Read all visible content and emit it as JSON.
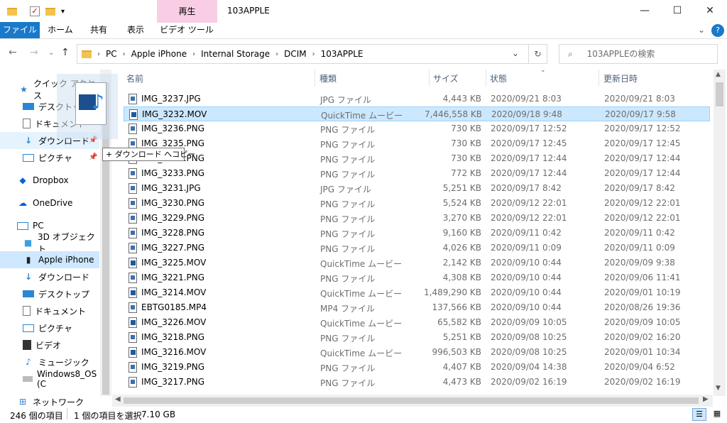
{
  "window": {
    "title": "103APPLE",
    "context_tab_label": "再生",
    "minimize": "—",
    "maximize": "☐",
    "close": "✕"
  },
  "ribbon": {
    "tabs": [
      "ファイル",
      "ホーム",
      "共有",
      "表示",
      "ビデオ ツール"
    ],
    "chevron": "⌄",
    "help": "?"
  },
  "address": {
    "crumbs": [
      "PC",
      "Apple iPhone",
      "Internal Storage",
      "DCIM",
      "103APPLE"
    ],
    "search_placeholder": "103APPLEの検索"
  },
  "sidebar": {
    "items": [
      {
        "label": "クイック アクセス",
        "icon": "star-icon"
      },
      {
        "label": "デスクトップ",
        "icon": "desktop-icon"
      },
      {
        "label": "ドキュメント",
        "icon": "document-icon"
      },
      {
        "label": "ダウンロード",
        "icon": "download-icon"
      },
      {
        "label": "ピクチャ",
        "icon": "picture-icon"
      },
      {
        "label": "Dropbox",
        "icon": "dropbox-icon"
      },
      {
        "label": "OneDrive",
        "icon": "onedrive-icon"
      },
      {
        "label": "PC",
        "icon": "pc-icon"
      },
      {
        "label": "3D オブジェクト",
        "icon": "cube-icon"
      },
      {
        "label": "Apple iPhone",
        "icon": "phone-icon"
      },
      {
        "label": "ダウンロード",
        "icon": "download-icon"
      },
      {
        "label": "デスクトップ",
        "icon": "desktop-icon"
      },
      {
        "label": "ドキュメント",
        "icon": "document-icon"
      },
      {
        "label": "ピクチャ",
        "icon": "picture-icon"
      },
      {
        "label": "ビデオ",
        "icon": "video-icon"
      },
      {
        "label": "ミュージック",
        "icon": "music-icon"
      },
      {
        "label": "Windows8_OS (C",
        "icon": "drive-icon"
      },
      {
        "label": "ネットワーク",
        "icon": "network-icon"
      }
    ]
  },
  "columns": {
    "name": "名前",
    "type": "種類",
    "size": "サイズ",
    "date": "状態",
    "modified": "更新日時"
  },
  "files": [
    {
      "name": "IMG_3237.JPG",
      "type": "JPG ファイル",
      "size": "4,443 KB",
      "date": "2020/09/21 8:03",
      "modified": "2020/09/21 8:03",
      "kind": "img"
    },
    {
      "name": "IMG_3232.MOV",
      "type": "QuickTime ムービー",
      "size": "7,446,558 KB",
      "date": "2020/09/18 9:48",
      "modified": "2020/09/17 9:58",
      "kind": "mov"
    },
    {
      "name": "IMG_3236.PNG",
      "type": "PNG ファイル",
      "size": "730 KB",
      "date": "2020/09/17 12:52",
      "modified": "2020/09/17 12:52",
      "kind": "img"
    },
    {
      "name": "IMG_3235.PNG",
      "type": "PNG ファイル",
      "size": "730 KB",
      "date": "2020/09/17 12:45",
      "modified": "2020/09/17 12:45",
      "kind": "img"
    },
    {
      "name": "IMG_3234.PNG",
      "type": "PNG ファイル",
      "size": "730 KB",
      "date": "2020/09/17 12:44",
      "modified": "2020/09/17 12:44",
      "kind": "img"
    },
    {
      "name": "IMG_3233.PNG",
      "type": "PNG ファイル",
      "size": "772 KB",
      "date": "2020/09/17 12:44",
      "modified": "2020/09/17 12:44",
      "kind": "img"
    },
    {
      "name": "IMG_3231.JPG",
      "type": "JPG ファイル",
      "size": "5,251 KB",
      "date": "2020/09/17 8:42",
      "modified": "2020/09/17 8:42",
      "kind": "img"
    },
    {
      "name": "IMG_3230.PNG",
      "type": "PNG ファイル",
      "size": "5,524 KB",
      "date": "2020/09/12 22:01",
      "modified": "2020/09/12 22:01",
      "kind": "img"
    },
    {
      "name": "IMG_3229.PNG",
      "type": "PNG ファイル",
      "size": "3,270 KB",
      "date": "2020/09/12 22:01",
      "modified": "2020/09/12 22:01",
      "kind": "img"
    },
    {
      "name": "IMG_3228.PNG",
      "type": "PNG ファイル",
      "size": "9,160 KB",
      "date": "2020/09/11 0:42",
      "modified": "2020/09/11 0:42",
      "kind": "img"
    },
    {
      "name": "IMG_3227.PNG",
      "type": "PNG ファイル",
      "size": "4,026 KB",
      "date": "2020/09/11 0:09",
      "modified": "2020/09/11 0:09",
      "kind": "img"
    },
    {
      "name": "IMG_3225.MOV",
      "type": "QuickTime ムービー",
      "size": "2,142 KB",
      "date": "2020/09/10 0:44",
      "modified": "2020/09/09 9:38",
      "kind": "mov"
    },
    {
      "name": "IMG_3221.PNG",
      "type": "PNG ファイル",
      "size": "4,308 KB",
      "date": "2020/09/10 0:44",
      "modified": "2020/09/06 11:41",
      "kind": "img"
    },
    {
      "name": "IMG_3214.MOV",
      "type": "QuickTime ムービー",
      "size": "1,489,290 KB",
      "date": "2020/09/10 0:44",
      "modified": "2020/09/01 10:19",
      "kind": "mov"
    },
    {
      "name": "EBTG0185.MP4",
      "type": "MP4 ファイル",
      "size": "137,566 KB",
      "date": "2020/09/10 0:44",
      "modified": "2020/08/26 19:36",
      "kind": "img"
    },
    {
      "name": "IMG_3226.MOV",
      "type": "QuickTime ムービー",
      "size": "65,582 KB",
      "date": "2020/09/09 10:05",
      "modified": "2020/09/09 10:05",
      "kind": "mov"
    },
    {
      "name": "IMG_3218.PNG",
      "type": "PNG ファイル",
      "size": "5,251 KB",
      "date": "2020/09/08 10:25",
      "modified": "2020/09/02 16:20",
      "kind": "img"
    },
    {
      "name": "IMG_3216.MOV",
      "type": "QuickTime ムービー",
      "size": "996,503 KB",
      "date": "2020/09/08 10:25",
      "modified": "2020/09/01 10:34",
      "kind": "mov"
    },
    {
      "name": "IMG_3219.PNG",
      "type": "PNG ファイル",
      "size": "4,407 KB",
      "date": "2020/09/04 14:38",
      "modified": "2020/09/04 6:52",
      "kind": "img"
    },
    {
      "name": "IMG_3217.PNG",
      "type": "PNG ファイル",
      "size": "4,473 KB",
      "date": "2020/09/02 16:19",
      "modified": "2020/09/02 16:19",
      "kind": "img"
    }
  ],
  "drag": {
    "tooltip": "+ ダウンロード へコピー"
  },
  "status": {
    "count": "246 個の項目",
    "selection": "1 個の項目を選択",
    "selection_size": "7.10 GB"
  },
  "colors": {
    "file_tab": "#1979ca",
    "context_tab": "#f9cde4",
    "selection": "#cce8ff"
  }
}
